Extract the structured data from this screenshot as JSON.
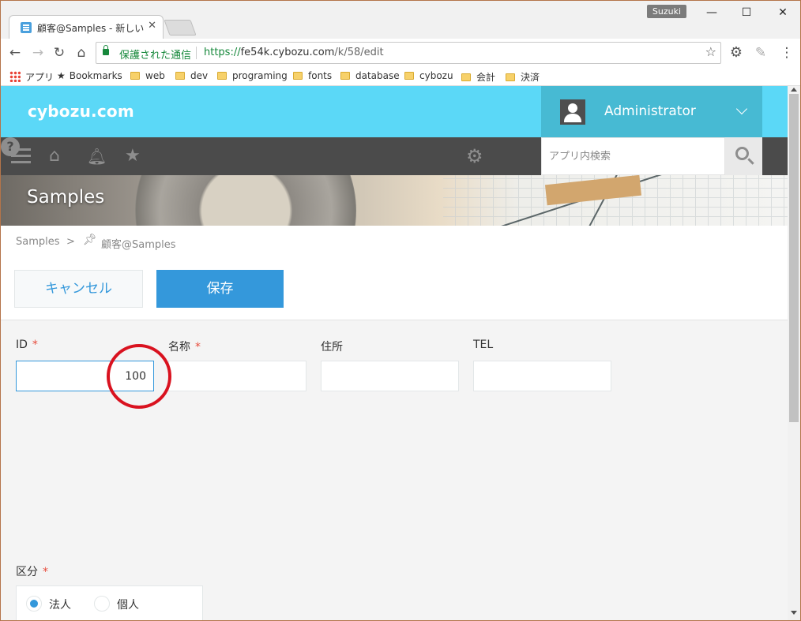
{
  "browser": {
    "tab_title": "顧客@Samples - 新しいレ",
    "tab_close": "✕",
    "profile_name": "Suzuki",
    "window_buttons": {
      "minimize": "—",
      "maximize": "☐",
      "close": "✕"
    },
    "security_label": "保護された通信",
    "url_protocol": "https://",
    "url_host": "fe54k.cybozu.com",
    "url_path": "/k/58/edit",
    "bookmarks": [
      {
        "label": "アプリ",
        "icon": "apps-grid-icon"
      },
      {
        "label": "Bookmarks",
        "icon": "star-icon"
      },
      {
        "label": "web",
        "icon": "folder-icon"
      },
      {
        "label": "dev",
        "icon": "folder-icon"
      },
      {
        "label": "programing",
        "icon": "folder-icon"
      },
      {
        "label": "fonts",
        "icon": "folder-icon"
      },
      {
        "label": "database",
        "icon": "folder-icon"
      },
      {
        "label": "cybozu",
        "icon": "folder-icon"
      },
      {
        "label": "会計",
        "icon": "folder-icon"
      },
      {
        "label": "決済",
        "icon": "folder-icon"
      }
    ]
  },
  "header": {
    "logo": "cybozu.com",
    "user_name": "Administrator"
  },
  "navbar": {
    "search_placeholder": "アプリ内検索"
  },
  "app": {
    "title": "Samples",
    "breadcrumb": [
      "Samples",
      ">",
      "顧客@Samples"
    ]
  },
  "actions": {
    "cancel_label": "キャンセル",
    "save_label": "保存"
  },
  "form": {
    "fields": [
      {
        "label": "ID",
        "required": "*",
        "value": "100"
      },
      {
        "label": "名称",
        "required": "*",
        "value": ""
      },
      {
        "label": "住所",
        "required": "",
        "value": ""
      },
      {
        "label": "TEL",
        "required": "",
        "value": ""
      }
    ],
    "kubun": {
      "label": "区分",
      "required": "*",
      "options": [
        {
          "label": "法人",
          "selected": true
        },
        {
          "label": "個人",
          "selected": false
        }
      ]
    }
  },
  "colors": {
    "header_bg": "#5bd8f7",
    "user_bg": "#47bad3",
    "navbar_bg": "#4b4b4b",
    "primary": "#3498db",
    "required": "#e74c3c",
    "annotation_circle": "#d9121f"
  }
}
